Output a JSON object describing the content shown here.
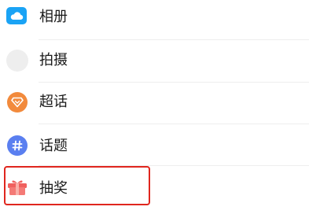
{
  "menu": {
    "items": [
      {
        "label": "相册",
        "icon": "album-cloud-icon",
        "color": "#1aa3f5"
      },
      {
        "label": "拍摄",
        "icon": "camera-placeholder-icon",
        "color": "#eeeeee"
      },
      {
        "label": "超话",
        "icon": "super-topic-diamond-icon",
        "color": "#f28a3c"
      },
      {
        "label": "话题",
        "icon": "hashtag-icon",
        "color": "#5a7ff0"
      },
      {
        "label": "抽奖",
        "icon": "gift-box-icon",
        "color": "#f05a5a"
      }
    ]
  },
  "highlight": {
    "color": "#e0261e"
  }
}
